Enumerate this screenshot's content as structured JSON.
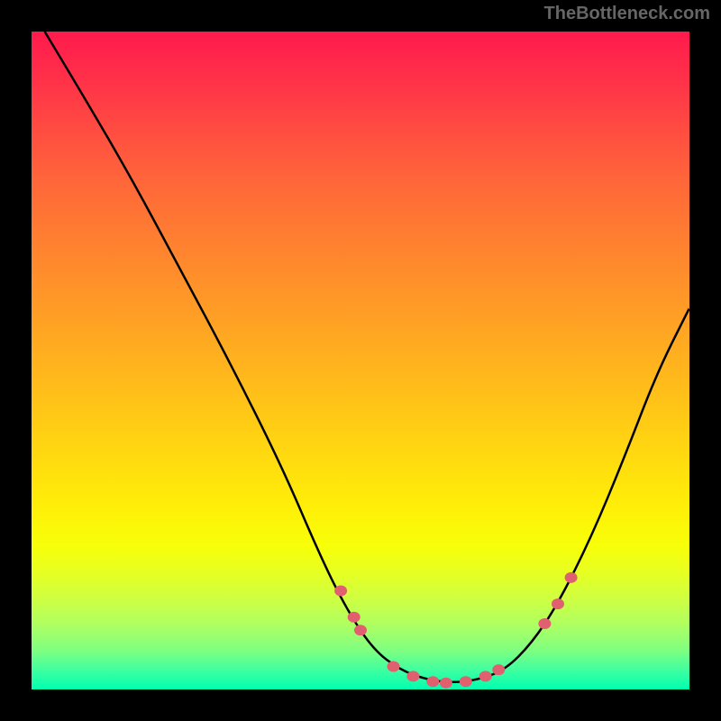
{
  "watermark": "TheBottleneck.com",
  "chart_data": {
    "type": "line",
    "title": "",
    "xlabel": "",
    "ylabel": "",
    "x_range": [
      0,
      100
    ],
    "y_range": [
      0,
      100
    ],
    "curve": [
      {
        "x": 2,
        "y": 100
      },
      {
        "x": 8,
        "y": 90
      },
      {
        "x": 15,
        "y": 78
      },
      {
        "x": 22,
        "y": 65
      },
      {
        "x": 30,
        "y": 50
      },
      {
        "x": 38,
        "y": 34
      },
      {
        "x": 44,
        "y": 20
      },
      {
        "x": 48,
        "y": 12
      },
      {
        "x": 52,
        "y": 6
      },
      {
        "x": 56,
        "y": 3
      },
      {
        "x": 60,
        "y": 1.5
      },
      {
        "x": 64,
        "y": 1
      },
      {
        "x": 68,
        "y": 1.5
      },
      {
        "x": 72,
        "y": 3
      },
      {
        "x": 76,
        "y": 7
      },
      {
        "x": 80,
        "y": 13
      },
      {
        "x": 85,
        "y": 23
      },
      {
        "x": 90,
        "y": 35
      },
      {
        "x": 95,
        "y": 48
      },
      {
        "x": 100,
        "y": 58
      }
    ],
    "markers": [
      {
        "x": 47,
        "y": 15
      },
      {
        "x": 49,
        "y": 11
      },
      {
        "x": 50,
        "y": 9
      },
      {
        "x": 55,
        "y": 3.5
      },
      {
        "x": 58,
        "y": 2
      },
      {
        "x": 61,
        "y": 1.2
      },
      {
        "x": 63,
        "y": 1
      },
      {
        "x": 66,
        "y": 1.2
      },
      {
        "x": 69,
        "y": 2
      },
      {
        "x": 71,
        "y": 3
      },
      {
        "x": 78,
        "y": 10
      },
      {
        "x": 80,
        "y": 13
      },
      {
        "x": 82,
        "y": 17
      }
    ],
    "marker_color": "#e06070",
    "curve_color": "#000000"
  }
}
